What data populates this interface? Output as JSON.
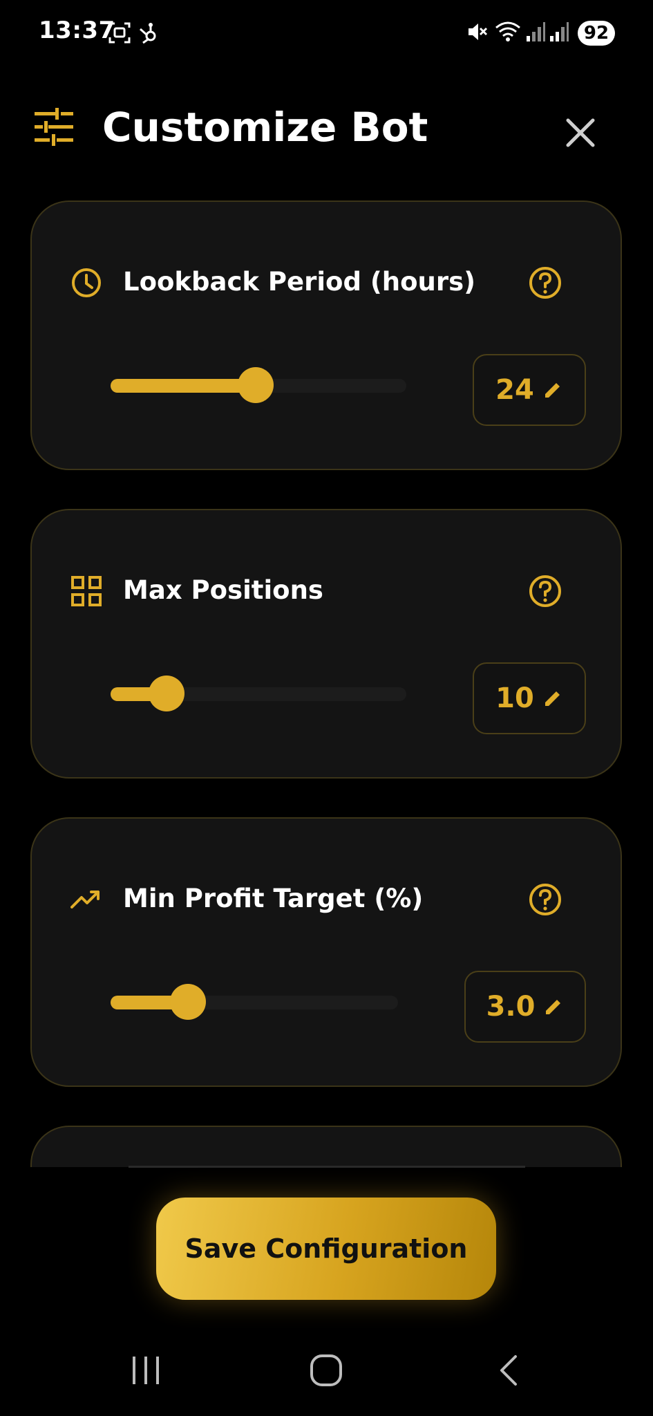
{
  "status_bar": {
    "time": "13:37",
    "battery": "92",
    "icons": [
      "screenshot-icon",
      "hubspot-icon",
      "mute-icon",
      "wifi-icon",
      "signal-icon",
      "signal-r-icon"
    ]
  },
  "header": {
    "title": "Customize Bot",
    "icon": "sliders-icon",
    "close_icon": "close-icon"
  },
  "settings": [
    {
      "label": "Lookback Period (hours)",
      "icon": "clock-icon",
      "value": "24",
      "fill_fraction": 0.49
    },
    {
      "label": "Max Positions",
      "icon": "grid-icon",
      "value": "10",
      "fill_fraction": 0.19
    },
    {
      "label": "Min Profit Target (%)",
      "icon": "trending-up-icon",
      "value": "3.0",
      "fill_fraction": 0.27
    }
  ],
  "save_button": {
    "label": "Save Configuration"
  },
  "colors": {
    "accent": "#e0ad29",
    "background": "#000000",
    "card": "#141414",
    "card_border": "#3b3418"
  },
  "nav_bar": {
    "icons": [
      "recent-apps-icon",
      "home-icon",
      "back-icon"
    ]
  }
}
